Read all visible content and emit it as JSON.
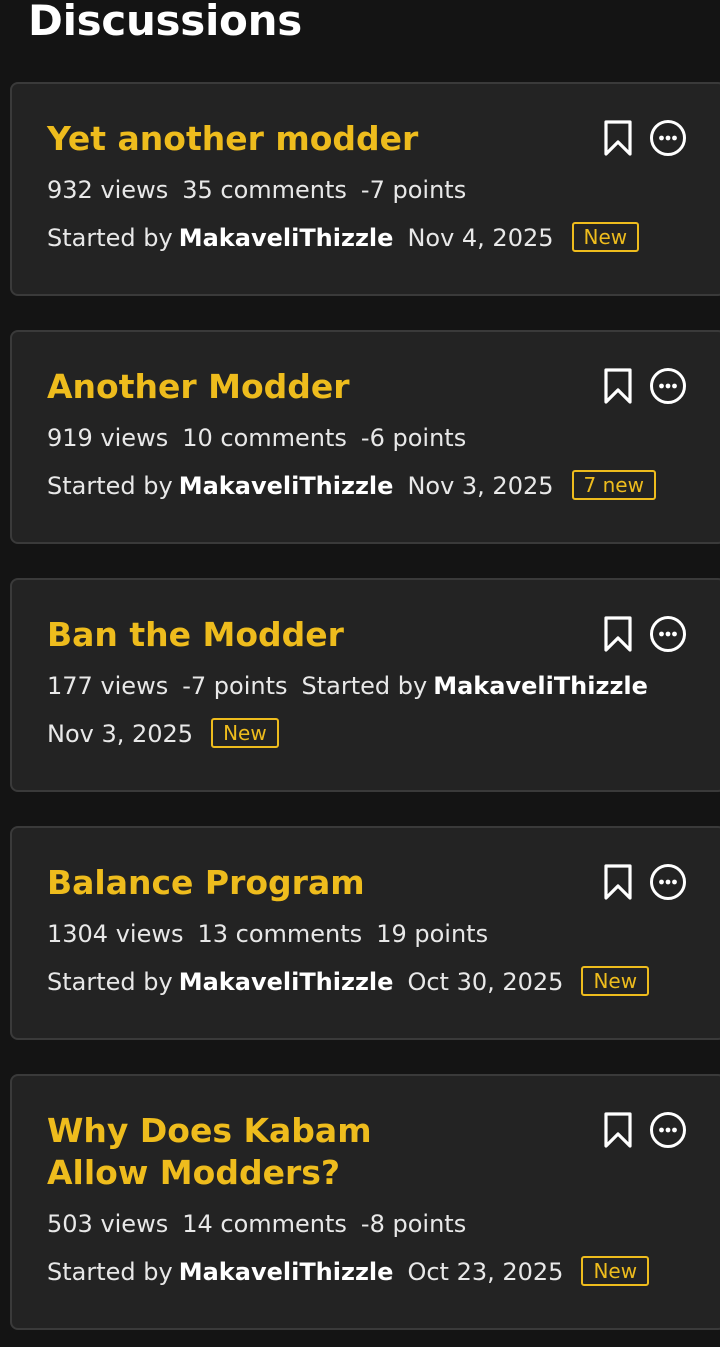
{
  "page": {
    "title": "Discussions"
  },
  "colors": {
    "accent": "#eebc1d",
    "card_bg": "#232323",
    "page_bg": "#141414"
  },
  "icons": {
    "bookmark": "bookmark-icon",
    "more": "more-options-icon"
  },
  "discussions": [
    {
      "title": "Yet another modder",
      "views": "932 views",
      "comments": "35 comments",
      "points": "-7 points",
      "started_by": "Started by",
      "author": "MakaveliThizzle",
      "date": "Nov 4, 2025",
      "badge": "New"
    },
    {
      "title": "Another Modder",
      "views": "919 views",
      "comments": "10 comments",
      "points": "-6 points",
      "started_by": "Started by",
      "author": "MakaveliThizzle",
      "date": "Nov 3, 2025",
      "badge": "7 new"
    },
    {
      "title": "Ban the Modder",
      "views": "177 views",
      "points": "-7 points",
      "started_by": "Started by",
      "author": "MakaveliThizzle",
      "date": "Nov 3, 2025",
      "badge": "New"
    },
    {
      "title": "Balance Program",
      "views": "1304 views",
      "comments": "13 comments",
      "points": "19 points",
      "started_by": "Started by",
      "author": "MakaveliThizzle",
      "date": "Oct 30, 2025",
      "badge": "New"
    },
    {
      "title": "Why Does Kabam Allow Modders?",
      "views": "503 views",
      "comments": "14 comments",
      "points": "-8 points",
      "started_by": "Started by",
      "author": "MakaveliThizzle",
      "date": "Oct 23, 2025",
      "badge": "New"
    }
  ]
}
